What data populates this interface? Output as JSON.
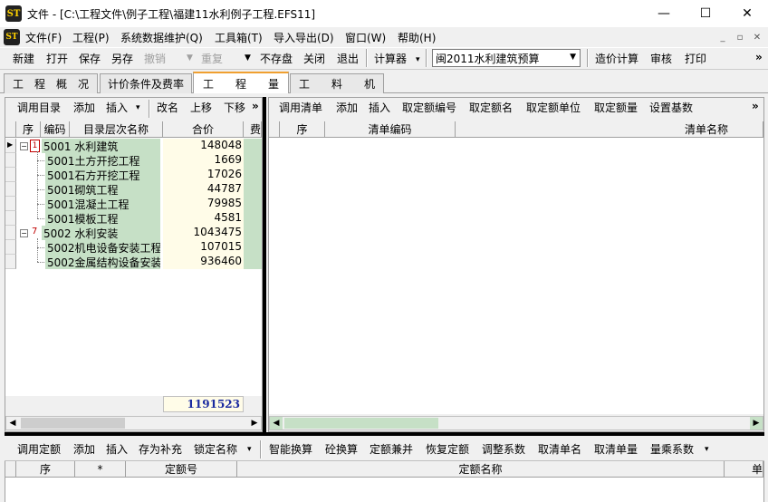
{
  "window": {
    "title": "文件 - [C:\\工程文件\\例子工程\\福建11水利例子工程.EFS11]",
    "icon_label": "ST",
    "minimize_glyph": "—",
    "maximize_glyph": "☐",
    "close_glyph": "✕"
  },
  "menubar": {
    "items": [
      "文件(F)",
      "工程(P)",
      "系统数据维护(Q)",
      "工具箱(T)",
      "导入导出(D)",
      "窗口(W)",
      "帮助(H)"
    ],
    "mdi_min": "_",
    "mdi_restore": "▫",
    "mdi_close": "✕"
  },
  "toolbar": {
    "new": "新建",
    "open": "打开",
    "save": "保存",
    "saveas": "另存",
    "undo": "撤销",
    "redo": "重复",
    "nosave": "不存盘",
    "close": "关闭",
    "exit": "退出",
    "calculator": "计算器",
    "quota_combo": "闽2011水利建筑预算",
    "cost_calc": "造价计算",
    "review": "审核",
    "print": "打印",
    "more": "»"
  },
  "tabs": [
    "工　程　概　况",
    "计价条件及费率",
    "工　　程　　量",
    "工　　料　　机"
  ],
  "active_tab": 2,
  "left_toolbar": {
    "call_catalog": "调用目录",
    "add": "添加",
    "insert": "插入",
    "rename": "改名",
    "move_up": "上移",
    "move_down": "下移",
    "more": "»"
  },
  "left_table": {
    "headers": [
      "序",
      "编码",
      "目录层次名称",
      "合价",
      "费"
    ],
    "rows": [
      {
        "marker": "1",
        "code": "5001",
        "name": "水利建筑",
        "amount": "148048",
        "level": 0
      },
      {
        "marker": "",
        "code": "5001",
        "name": "土方开挖工程",
        "amount": "1669",
        "level": 1
      },
      {
        "marker": "",
        "code": "5001",
        "name": "石方开挖工程",
        "amount": "17026",
        "level": 1
      },
      {
        "marker": "",
        "code": "5001",
        "name": "砌筑工程",
        "amount": "44787",
        "level": 1
      },
      {
        "marker": "",
        "code": "5001",
        "name": "混凝土工程",
        "amount": "79985",
        "level": 1
      },
      {
        "marker": "",
        "code": "5001",
        "name": "模板工程",
        "amount": "4581",
        "level": 1
      },
      {
        "marker": "7",
        "code": "5002",
        "name": "水利安装",
        "amount": "1043475",
        "level": 0
      },
      {
        "marker": "",
        "code": "5002",
        "name": "机电设备安装工程",
        "amount": "107015",
        "level": 1
      },
      {
        "marker": "",
        "code": "5002",
        "name": "金属结构设备安装",
        "amount": "936460",
        "level": 1
      }
    ],
    "total": "1191523"
  },
  "right_toolbar": {
    "items": [
      "调用清单",
      "添加",
      "插入",
      "取定额编号",
      "取定额名",
      "取定额单位",
      "取定额量",
      "设置基数"
    ],
    "more": "»"
  },
  "right_table": {
    "headers": [
      "序",
      "清单编码",
      "清单名称"
    ]
  },
  "bottom_toolbar": {
    "items_left": [
      "调用定额",
      "添加",
      "插入",
      "存为补充",
      "锁定名称"
    ],
    "items_right": [
      "智能换算",
      "砼换算",
      "定额兼并",
      "恢复定额",
      "调整系数",
      "取清单名",
      "取清单量",
      "量乘系数"
    ]
  },
  "bottom_table": {
    "headers": [
      "序",
      "*",
      "定额号",
      "定额名称",
      "单"
    ]
  },
  "colors": {
    "tree_code_bg": "#c6e0c6",
    "amount_bg": "#fffce8",
    "total_text": "#1a2aa0",
    "divider": "#000000"
  }
}
